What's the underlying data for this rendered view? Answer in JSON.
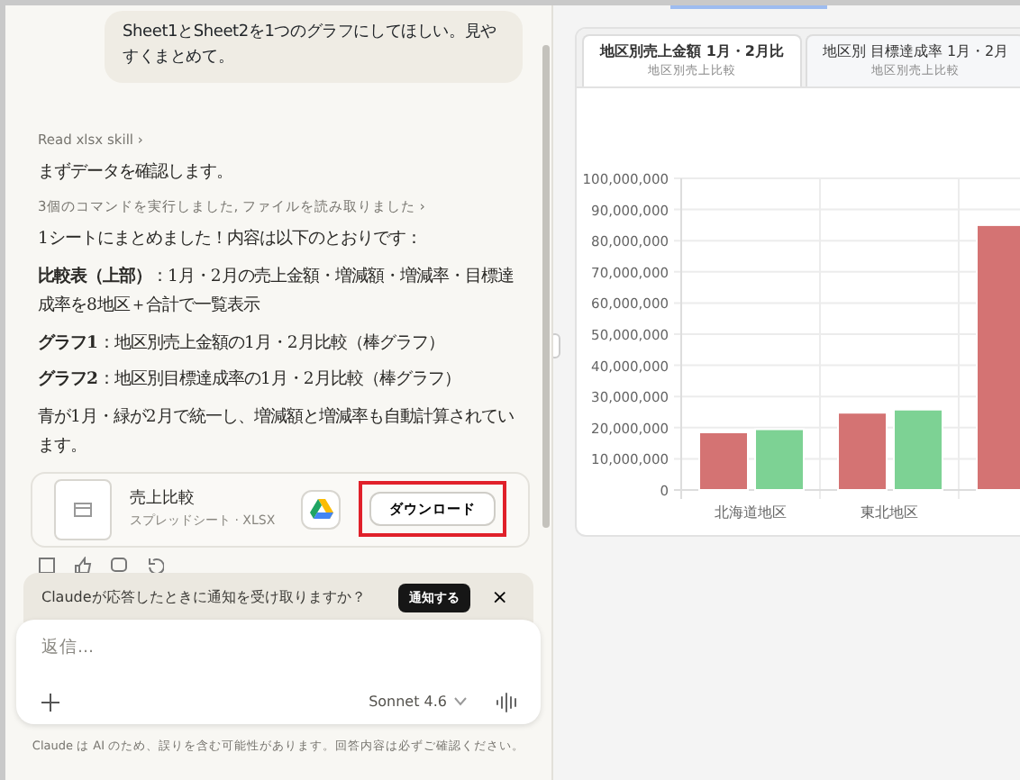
{
  "chat": {
    "user_message": "Sheet1とSheet2を1つのグラフにしてほしい。見やすくまとめて。",
    "steps": [
      {
        "kind": "tool",
        "text": "Read xlsx skill ›"
      },
      {
        "kind": "para",
        "text": "まずデータを確認します。"
      },
      {
        "kind": "tool",
        "text": "3個のコマンドを実行しました, ファイルを読み取りました ›"
      },
      {
        "kind": "para",
        "text": "1シートにまとめました！内容は以下のとおりです："
      },
      {
        "kind": "para",
        "text": "**比較表（上部）**：1月・2月の売上金額・増減額・増減率・目標達成率を8地区＋合計で一覧表示"
      },
      {
        "kind": "para",
        "text": "**グラフ1**：地区別売上金額の1月・2月比較（棒グラフ）"
      },
      {
        "kind": "para",
        "text": "**グラフ2**：地区別目標達成率の1月・2月比較（棒グラフ）"
      },
      {
        "kind": "para",
        "text": "青が1月・緑が2月で統一し、増減額と増減率も自動計算されています。"
      }
    ],
    "file": {
      "title": "売上比較",
      "subtitle": "スプレッドシート · XLSX",
      "download": "ダウンロード",
      "highlighted": true
    },
    "notification": {
      "text": "Claudeが応答したときに通知を受け取りますか？",
      "button": "通知する",
      "close": "×"
    },
    "composer": {
      "placeholder": "返信...",
      "model": "Sonnet 4.6"
    },
    "footer": "Claude は AI のため、誤りを含む可能性があります。回答内容は必ずご確認ください。"
  },
  "artifact": {
    "tabs": [
      {
        "title": "地区別売上金額 1月・2月比",
        "subtitle": "地区別売上比較",
        "selected": true
      },
      {
        "title": "地区別 目標達成率 1月・2月",
        "subtitle": "地区別売上比較",
        "selected": false
      }
    ],
    "chart_data": {
      "type": "bar",
      "categories": [
        "北海道地区",
        "東北地区",
        null
      ],
      "series": [
        {
          "color": "#d47373",
          "values": [
            18500000,
            24800000,
            85000000
          ]
        },
        {
          "color": "#7dd294",
          "values": [
            19500000,
            25800000,
            null
          ]
        }
      ],
      "ylim": [
        0,
        100000000
      ],
      "grid": true,
      "yticks": [
        {
          "value": 0,
          "label": "0"
        },
        {
          "value": 10000000,
          "label": "10,000,000"
        },
        {
          "value": 20000000,
          "label": "20,000,000"
        },
        {
          "value": 30000000,
          "label": "30,000,000"
        },
        {
          "value": 40000000,
          "label": "40,000,000"
        },
        {
          "value": 50000000,
          "label": "50,000,000"
        },
        {
          "value": 60000000,
          "label": "60,000,000"
        },
        {
          "value": 70000000,
          "label": "70,000,000"
        },
        {
          "value": 80000000,
          "label": "80,000,000"
        },
        {
          "value": 90000000,
          "label": "90,000,000"
        },
        {
          "value": 100000000,
          "label": "100,000,000"
        }
      ]
    }
  }
}
